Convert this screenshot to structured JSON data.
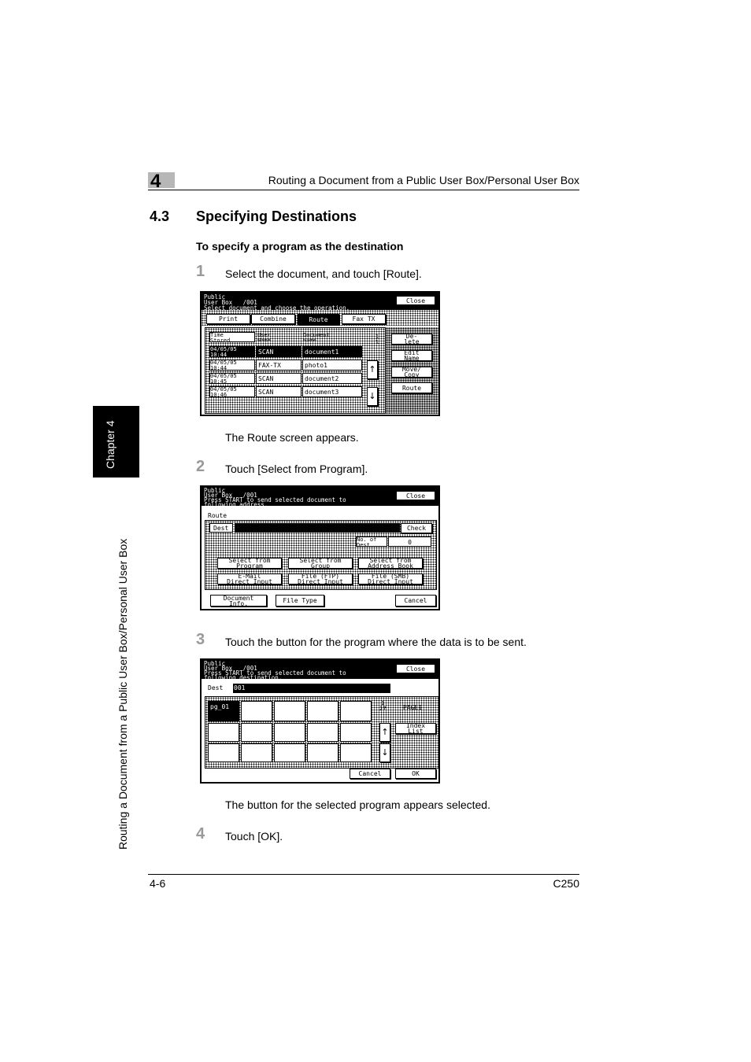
{
  "header": {
    "chapter_number": "4",
    "title": "Routing a Document from a Public User Box/Personal User Box"
  },
  "section": {
    "number": "4.3",
    "title": "Specifying Destinations"
  },
  "procedure_title": "To specify a program as the destination",
  "steps": [
    {
      "num": "1",
      "text": "Select the document, and touch [Route].",
      "result": "The Route screen appears."
    },
    {
      "num": "2",
      "text": "Touch [Select from Program]."
    },
    {
      "num": "3",
      "text": "Touch the button for the program where the data is to be sent.",
      "result": "The button for the selected program appears selected."
    },
    {
      "num": "4",
      "text": "Touch [OK]."
    }
  ],
  "side_tab": {
    "label": "Chapter 4",
    "running_title": "Routing a Document from a Public User Box/Personal User Box"
  },
  "footer": {
    "page": "4-6",
    "model": "C250"
  },
  "screen1": {
    "title_text": "Public\nUser Box   /001\nSelect document and choose the operation.",
    "close": "Close",
    "tabs": [
      "Print",
      "Combine",
      "Route",
      "Fax TX"
    ],
    "columns": [
      "Time\nStored",
      "User\nName",
      "Document\nName"
    ],
    "page_indicator": "1\n1",
    "rows": [
      {
        "time": "04/05/05\n10:44",
        "user": "SCAN",
        "doc": "document1"
      },
      {
        "time": "04/05/05\n10:44",
        "user": "FAX-TX",
        "doc": "photo1"
      },
      {
        "time": "04/05/05\n10:45",
        "user": "SCAN",
        "doc": "document2"
      },
      {
        "time": "04/05/05\n10:46",
        "user": "SCAN",
        "doc": "document3"
      }
    ],
    "side_buttons": [
      "De-\nlete",
      "Edit\nName",
      "Move/\nCopy",
      "Route"
    ]
  },
  "screen2": {
    "title_text": "Public\nUser Box   /001\nPress START to send selected document to\nfollowing address.",
    "close": "Close",
    "route_label": "Route",
    "dest_label": "Dest",
    "check": "Check",
    "num_dest_label": "No. of\nDest.",
    "num_dest_value": "0",
    "buttons": [
      "Select from\nProgram",
      "Select from\nGroup",
      "Select from\nAddress Book",
      "E-Mail\nDirect Input",
      "File (FTP)\nDirect Input",
      "File (SMB)\nDirect Input"
    ],
    "document_info": "Document\nInfo.",
    "file_type": "File Type",
    "cancel": "Cancel"
  },
  "screen3": {
    "title_text": "Public\nUser Box   /001\nPress START to send selected document to\nfollowing destination.",
    "close": "Close",
    "dest_label": "Dest",
    "dest_value": "001",
    "selected_program": "pg_01",
    "page_counter": "1\n27",
    "page_label": "PAGE1",
    "index_list": "Index\nList",
    "cancel": "Cancel",
    "ok": "OK"
  }
}
